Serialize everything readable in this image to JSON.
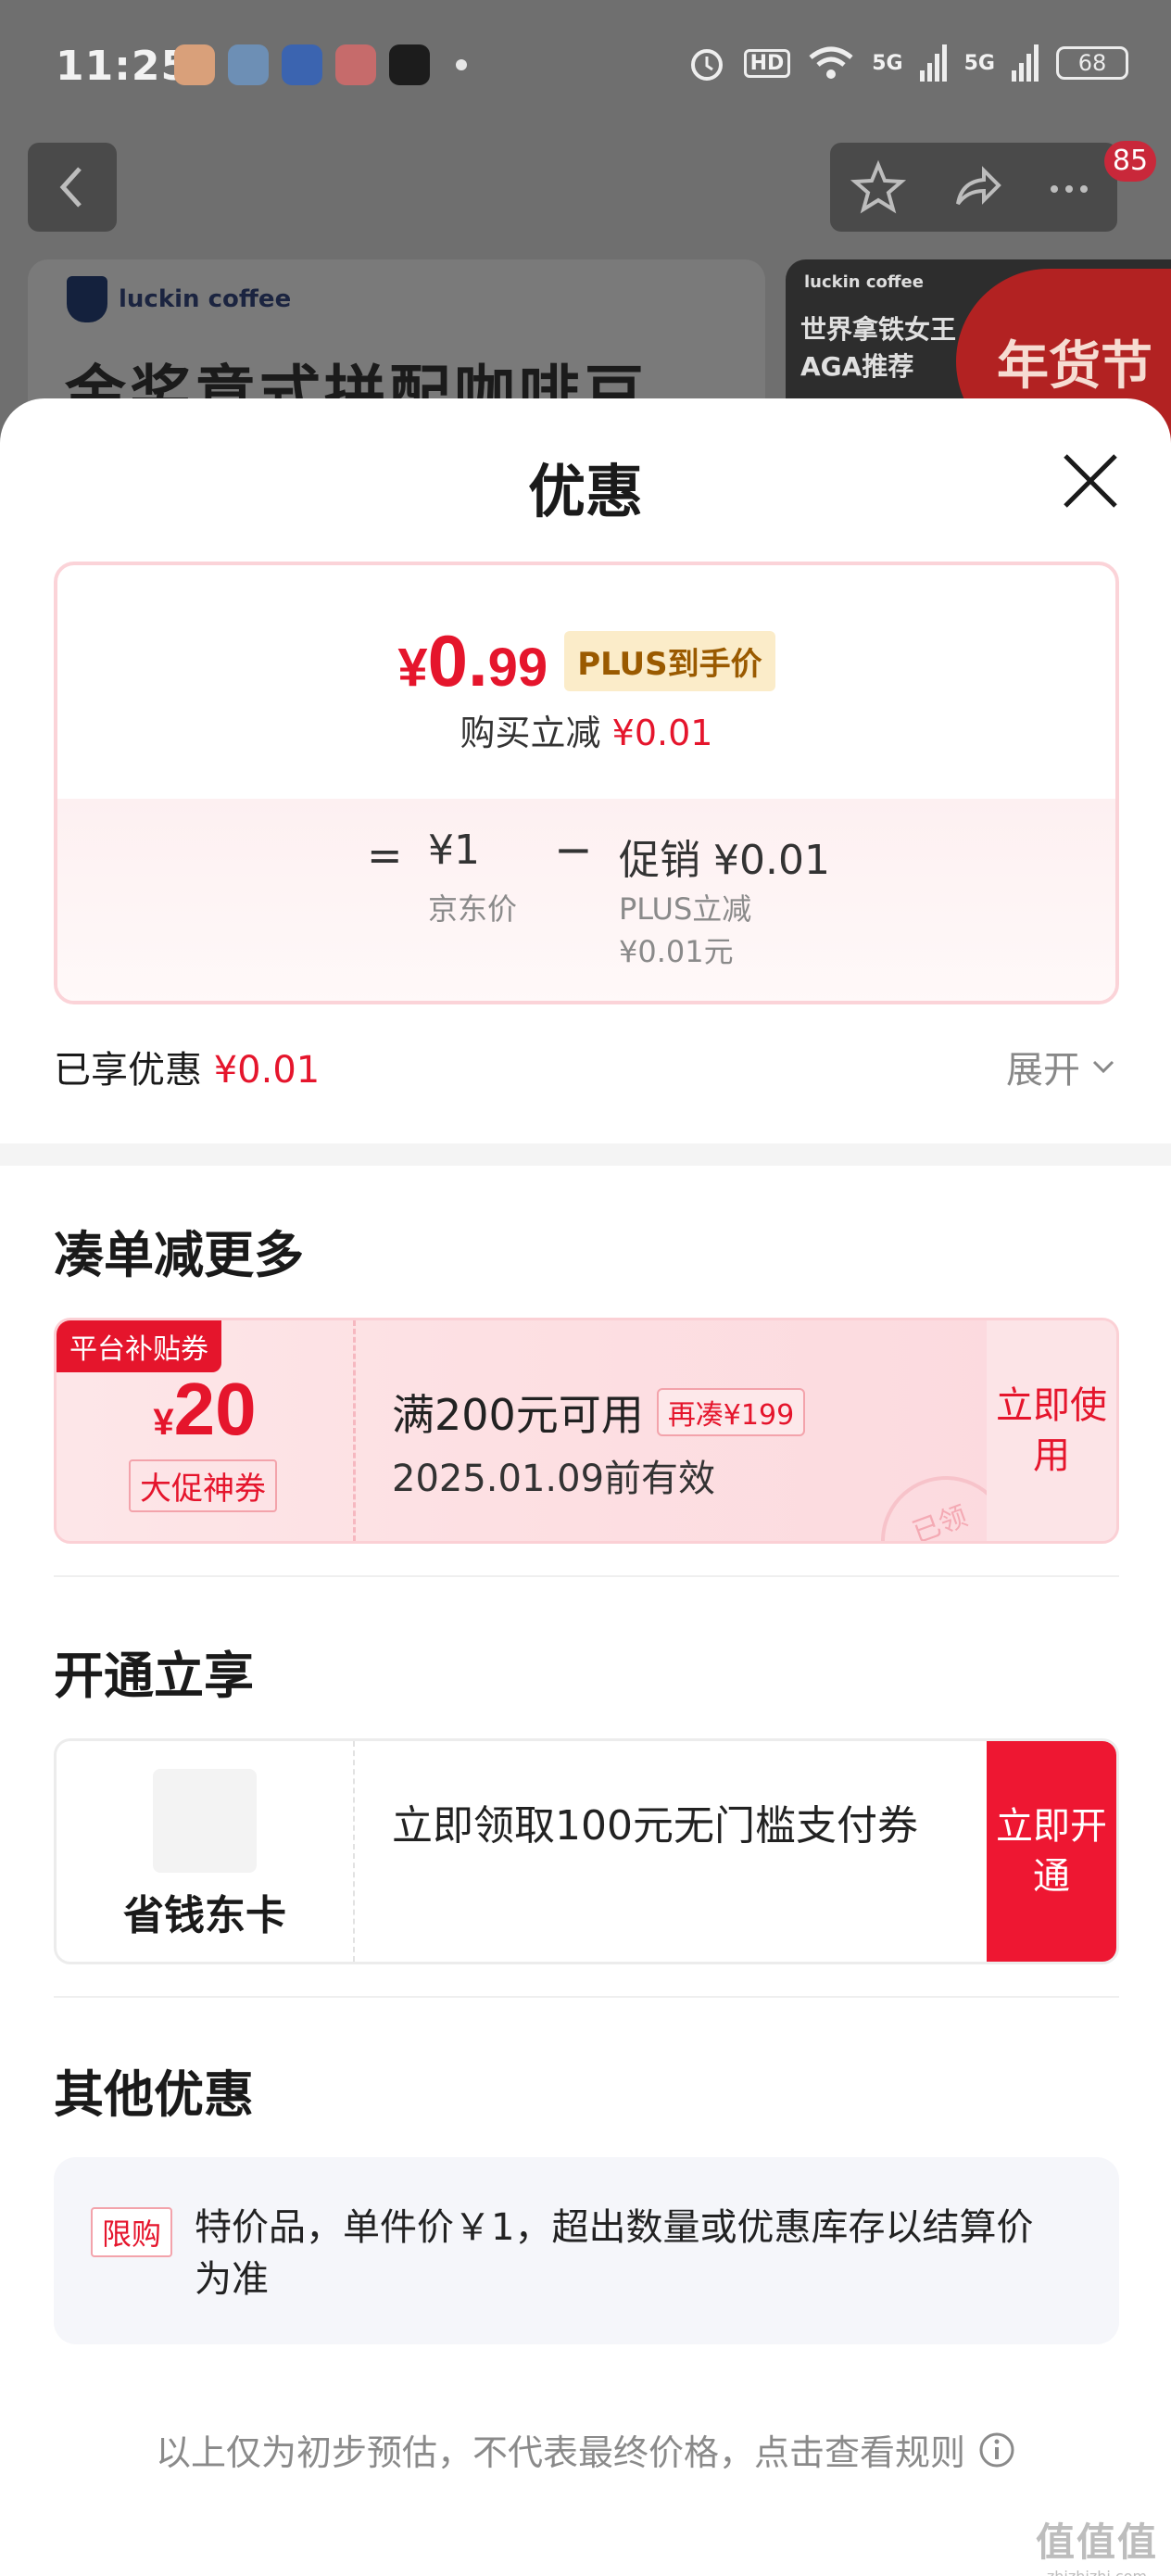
{
  "status_bar": {
    "time": "11:25",
    "hd": "HD",
    "net1": "5G",
    "net2": "5G",
    "battery": "68"
  },
  "nav": {
    "badge": "85"
  },
  "banner": {
    "brand": "luckin coffee",
    "title": "金奖意式拼配咖啡豆",
    "right_brand": "luckin coffee",
    "right_text": "世界拿铁女王 AGA推荐",
    "right_red": "年货节"
  },
  "sheet": {
    "title": "优惠",
    "price": {
      "currency": "¥",
      "int": "0.",
      "dec": "99",
      "plus_tag": "PLUS到手价"
    },
    "reduce": {
      "label": "购买立减 ",
      "value": "¥0.01"
    },
    "breakdown": {
      "equals": "=",
      "jd_price": "¥1",
      "jd_label": "京东价",
      "minus": "−",
      "promo": "促销 ¥0.01",
      "promo_sub1": "PLUS立减",
      "promo_sub2": "¥0.01元"
    },
    "enjoyed": {
      "label": "已享优惠 ",
      "value": "¥0.01"
    },
    "expand": "展开"
  },
  "section_coupons": {
    "title": "凑单减更多",
    "coupon": {
      "tag": "平台补贴券",
      "currency": "¥",
      "amount": "20",
      "badge": "大促神券",
      "condition": "满200元可用",
      "more": "再凑¥199",
      "expiry": "2025.01.09前有效",
      "stamp": "已领",
      "button": "立即使用"
    }
  },
  "section_member": {
    "title": "开通立享",
    "name": "省钱东卡",
    "desc": "立即领取100元无门槛支付券",
    "button": "立即开通"
  },
  "section_other": {
    "title": "其他优惠",
    "tag": "限购",
    "text": "特价品，单件价￥1，超出数量或优惠库存以结算价为准"
  },
  "footer": {
    "note": "以上仅为初步预估，不代表最终价格，点击查看规则"
  },
  "watermark": {
    "big": "值值值",
    "small": "zhizhizhi.com"
  }
}
